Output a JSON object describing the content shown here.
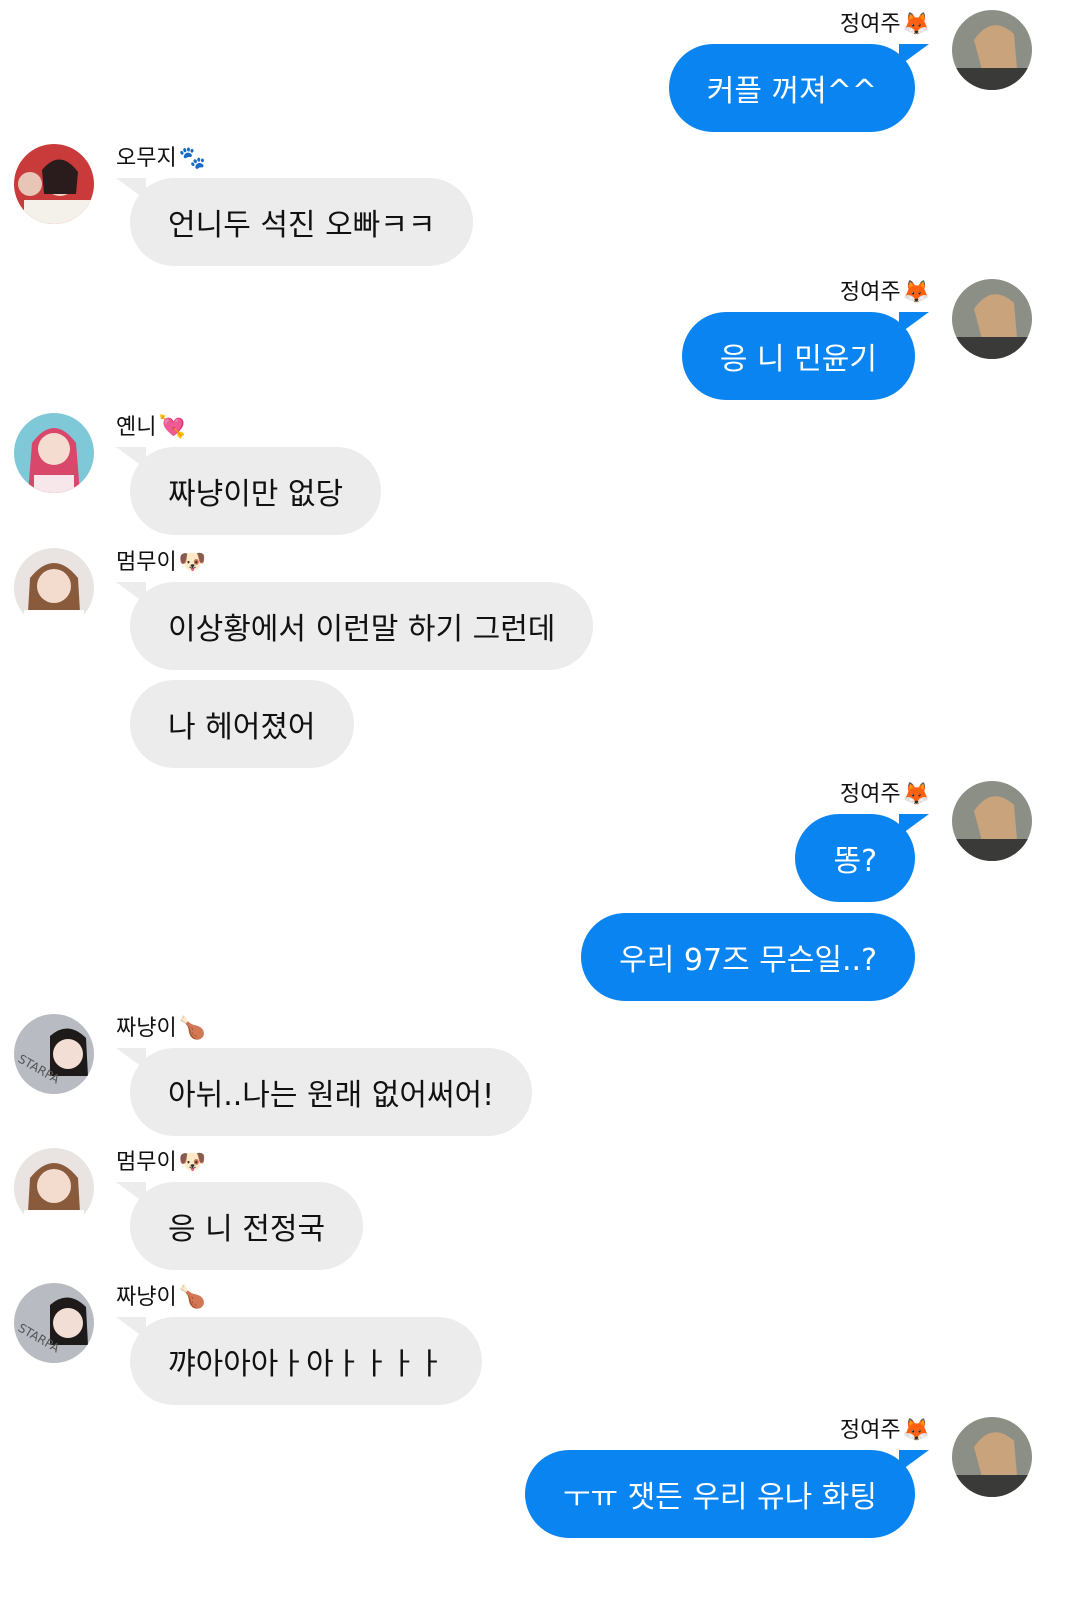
{
  "colors": {
    "outgoing_bubble": "#0a84f0",
    "incoming_bubble": "#ececec",
    "background": "#ffffff"
  },
  "messages": [
    {
      "sender": "정여주",
      "emoji": "🦊",
      "side": "right",
      "text": "커플 꺼져^^"
    },
    {
      "sender": "오무지",
      "emoji": "🐾",
      "side": "left",
      "text": "언니두 석진 오빠ㅋㅋ"
    },
    {
      "sender": "정여주",
      "emoji": "🦊",
      "side": "right",
      "text": "응 니 민윤기"
    },
    {
      "sender": "옌니",
      "emoji": "💘",
      "side": "left",
      "text": "짜냥이만 없당"
    },
    {
      "sender": "멈무이",
      "emoji": "🐶",
      "side": "left",
      "text": "이상황에서 이런말 하기 그런데"
    },
    {
      "sender": "",
      "emoji": "",
      "side": "left",
      "text": "나 헤어졌어"
    },
    {
      "sender": "정여주",
      "emoji": "🦊",
      "side": "right",
      "text": "똥?"
    },
    {
      "sender": "",
      "emoji": "",
      "side": "right",
      "text": "우리 97즈 무슨일..?"
    },
    {
      "sender": "짜냥이",
      "emoji": "🍗",
      "side": "left",
      "text": "아뉘..나는 원래 없어써어!"
    },
    {
      "sender": "멈무이",
      "emoji": "🐶",
      "side": "left",
      "text": "응 니 전정국"
    },
    {
      "sender": "짜냥이",
      "emoji": "🍗",
      "side": "left",
      "text": "꺄아아아ㅏ아ㅏㅏㅏㅏ"
    },
    {
      "sender": "정여주",
      "emoji": "🦊",
      "side": "right",
      "text": "ㅜㅠ 잿든 우리 유나 화팅"
    }
  ]
}
